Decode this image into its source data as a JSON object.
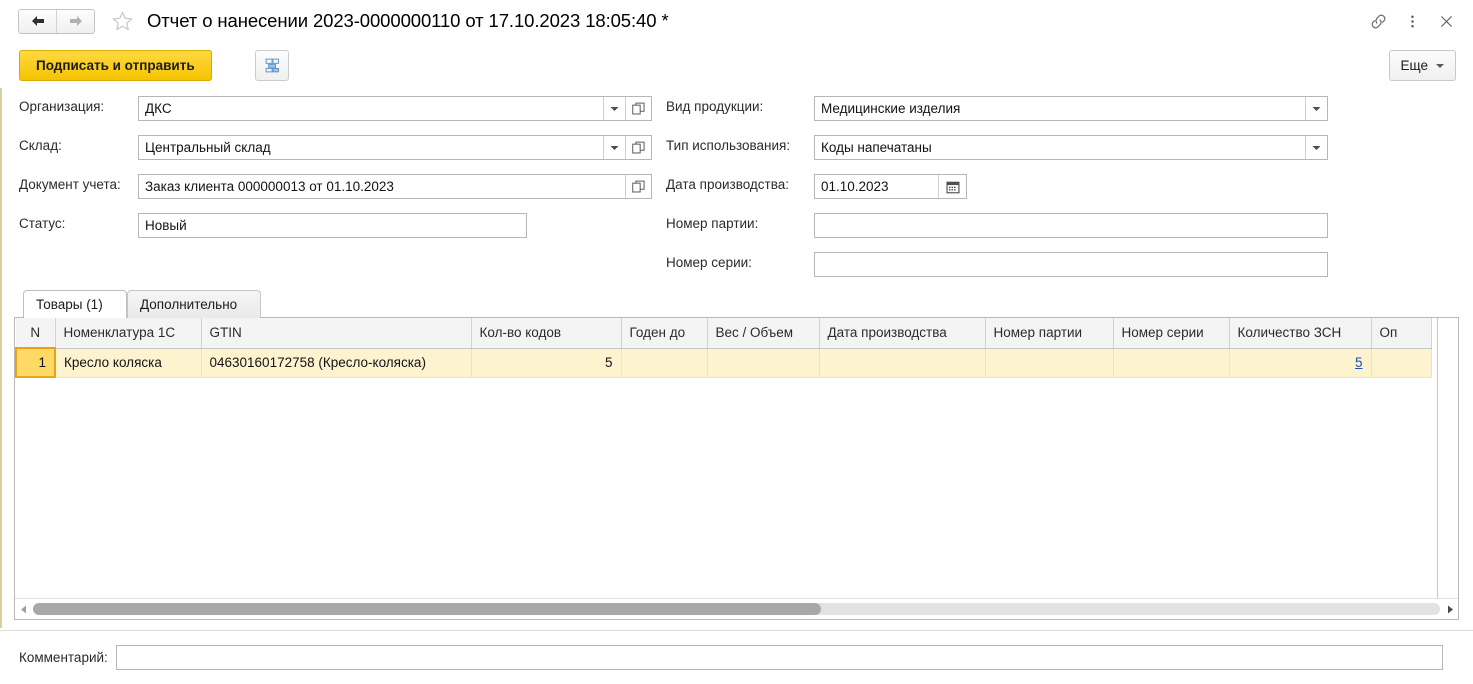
{
  "window": {
    "title": "Отчет о нанесении 2023-0000000110 от 17.10.2023 18:05:40 *",
    "back_icon": "arrow-left-icon",
    "forward_icon": "arrow-right-icon",
    "favorite_icon": "star-icon",
    "link_icon": "link-icon",
    "menu_icon": "more-vertical-icon",
    "close_icon": "close-icon"
  },
  "commandbar": {
    "sign_and_send": "Подписать и отправить",
    "structure_icon": "hierarchy-icon",
    "more_label": "Еще",
    "more_caret_icon": "chevron-down-icon"
  },
  "form": {
    "left": [
      {
        "label": "Организация:",
        "value": "ДКС",
        "has_dropdown": true,
        "has_open": true
      },
      {
        "label": "Склад:",
        "value": "Центральный склад",
        "has_dropdown": true,
        "has_open": true
      },
      {
        "label": "Документ учета:",
        "value": "Заказ клиента 000000013 от 01.10.2023",
        "has_dropdown": false,
        "has_open": true
      },
      {
        "label": "Статус:",
        "value": "Новый",
        "has_dropdown": false,
        "has_open": false
      }
    ],
    "right": [
      {
        "label": "Вид продукции:",
        "value": "Медицинские изделия",
        "has_dropdown": true
      },
      {
        "label": "Тип использования:",
        "value": "Коды напечатаны",
        "has_dropdown": true
      },
      {
        "label": "Дата производства:",
        "value": "01.10.2023",
        "has_calendar": true
      },
      {
        "label": "Номер партии:",
        "value": ""
      },
      {
        "label": "Номер серии:",
        "value": ""
      }
    ]
  },
  "tabs": [
    {
      "label": "Товары (1)",
      "active": true
    },
    {
      "label": "Дополнительно",
      "active": false
    }
  ],
  "table": {
    "columns": [
      "N",
      "Номенклатура 1С",
      "GTIN",
      "Кол-во кодов",
      "Годен до",
      "Вес / Объем",
      "Дата производства",
      "Номер партии",
      "Номер серии",
      "Количество ЗСН",
      "Оп"
    ],
    "rows": [
      {
        "n": "1",
        "nomenclature": "Кресло коляска",
        "gtin": "04630160172758 (Кресло-коляска)",
        "codes_count": "5",
        "good_until": "",
        "weight_volume": "",
        "production_date": "",
        "batch_number": "",
        "series_number": "",
        "zsn_count": "5",
        "last": ""
      }
    ],
    "scroll_left_icon": "triangle-left-icon",
    "scroll_right_icon": "triangle-right-icon"
  },
  "footer": {
    "comment_label": "Комментарий:",
    "comment_value": "",
    "comment_placeholder": ""
  },
  "colors": {
    "accent_yellow": "#f5c400",
    "row_highlight": "#fdf3cf",
    "selected_cell": "#ffd966",
    "link_blue": "#1c4fb8"
  }
}
